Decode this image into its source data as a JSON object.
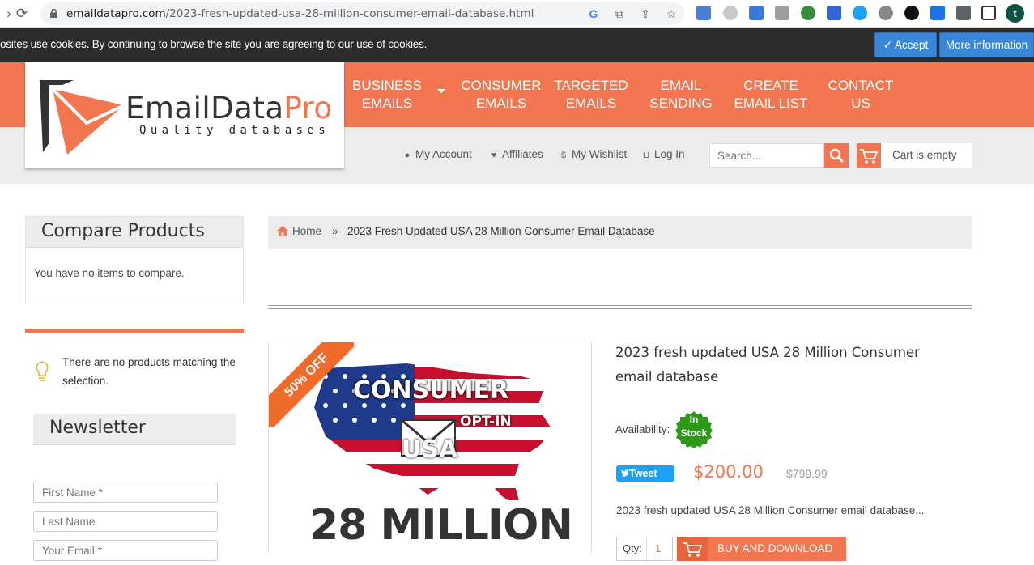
{
  "browser": {
    "url_domain": "emaildatapro.com",
    "url_path": "/2023-fresh-updated-usa-28-million-consumer-email-database.html",
    "profile_initial": "t"
  },
  "cookie_bar": {
    "text": "osites use cookies. By continuing to browse the site you are agreeing to our use of cookies.",
    "accept_label": "✓ Accept",
    "more_info_label": "More information"
  },
  "logo": {
    "title_main": "EmailData",
    "title_accent": "Pro",
    "tagline": "Quality databases"
  },
  "menu": {
    "items": [
      {
        "line1": "Business",
        "line2": "Emails"
      },
      {
        "line1": "Consumer",
        "line2": "Emails"
      },
      {
        "line1": "Targeted",
        "line2": "Emails"
      },
      {
        "line1": "Email",
        "line2": "Sending"
      },
      {
        "line1": "Create",
        "line2": "Email List"
      },
      {
        "line1": "Contact",
        "line2": "Us"
      }
    ]
  },
  "toplinks": {
    "account": "My Account",
    "affiliates": "Affiliates",
    "wishlist": "My Wishlist",
    "login": "Log In"
  },
  "search": {
    "placeholder": "Search..."
  },
  "cart": {
    "label": "Cart is empty"
  },
  "compare": {
    "title": "Compare Products",
    "empty_text": "You have no items to compare."
  },
  "sidebar_notice": "There are no products matching the selection.",
  "newsletter": {
    "title": "Newsletter",
    "first_name_placeholder": "First Name *",
    "last_name_placeholder": "Last Name",
    "email_placeholder": "Your Email *"
  },
  "breadcrumb": {
    "home": "Home",
    "separator": "»",
    "current": "2023 Fresh Updated USA 28 Million Consumer Email Database"
  },
  "product_image": {
    "ribbon": "50% OFF",
    "consumer": "CONSUMER",
    "optin": "OPT-IN",
    "usa": "USA",
    "million": "28 MILLION"
  },
  "product": {
    "title": "2023 fresh updated USA 28 Million Consumer email database",
    "availability_label": "Availability:",
    "stock_line1": "In",
    "stock_line2": "Stock",
    "tweet_label": "Tweet",
    "price": "$200.00",
    "old_price": "$799.99",
    "short_description": "2023 fresh updated USA 28 Million Consumer email database...",
    "qty_label": "Qty:",
    "qty_value": "1",
    "buy_label": "Buy and Download"
  },
  "colors": {
    "brand_orange": "#f2764f",
    "accept_blue": "#3a87d8",
    "stock_green": "#2d9a17",
    "tweet_blue": "#1da1f2"
  }
}
